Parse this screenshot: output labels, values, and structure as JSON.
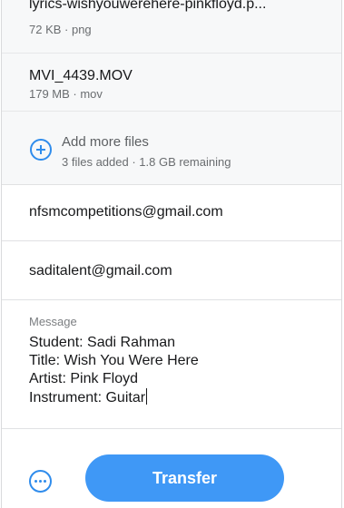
{
  "files": [
    {
      "name": "lyrics-wishyouwerehere-pinkfloyd.p...",
      "meta": "72 KB · png"
    },
    {
      "name": "MVI_4439.MOV",
      "meta": "179 MB · mov"
    }
  ],
  "add_more": {
    "icon": "plus-circle-icon",
    "title": "Add more files",
    "subtitle": "3 files added · 1.8 GB remaining"
  },
  "recipients": [
    "nfsmcompetitions@gmail.com",
    "saditalent@gmail.com"
  ],
  "message": {
    "label": "Message",
    "text": "Student: Sadi Rahman\nTitle: Wish You Were Here\nArtist: Pink Floyd\nInstrument: Guitar"
  },
  "footer": {
    "options_icon": "more-options-icon",
    "transfer_label": "Transfer"
  },
  "colors": {
    "accent": "#3f98f6",
    "icon_blue": "#2f8cec"
  }
}
